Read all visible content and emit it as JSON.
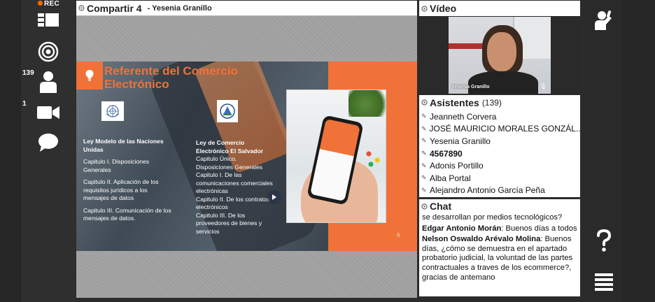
{
  "recording": {
    "label": "REC"
  },
  "toolbar": {
    "participants_count": "139",
    "camera_count": "1"
  },
  "share": {
    "title": "Compartir 4",
    "presenter": "- Yesenia Granillo",
    "slide": {
      "title": "Referente del Comercio Electrónico",
      "col1_heading": "Ley Modelo de las Naciones Unidas",
      "col1_items": [
        "Capitulo I. Disposiciones Generales",
        "Capitulo II. Aplicación de los requisitos jurídicos a los mensajes de datos",
        "Capitulo III. Comunicación de los mensajes de datos."
      ],
      "col2_heading": "Ley de Comercio Electrónico El Salvador",
      "col2_items": [
        "Capitulo Único. Disposiciones Generales",
        "Capitulo I. De las comunicaciones comerciales electrónicas",
        "Capitulo II. De los contratos electrónicos",
        "Capitulo III. De los proveedores de bienes y servicios"
      ],
      "page_number": "6"
    }
  },
  "video": {
    "title": "Vídeo",
    "participant_name": "Yesenia Granillo"
  },
  "attendees": {
    "title": "Asistentes",
    "count": "(139)",
    "list": [
      {
        "name": "Jeanneth Corvera",
        "bold": false
      },
      {
        "name": "JOSÉ MAURICIO MORALES GONZÁL...",
        "bold": false
      },
      {
        "name": "Yesenia Granillo",
        "bold": false
      },
      {
        "name": "4567890",
        "bold": true
      },
      {
        "name": "Adonis Portillo",
        "bold": false
      },
      {
        "name": "Alba Portal",
        "bold": false
      },
      {
        "name": "Alejandro Antonio García Peña",
        "bold": false
      }
    ]
  },
  "chat": {
    "title": "Chat",
    "messages": [
      {
        "author": "",
        "text": "se desarrollan por medios tecnológicos?"
      },
      {
        "author": "Edgar Antonio Morán",
        "text": ": Buenos días a todos"
      },
      {
        "author": "Nelson Oswaldo Arévalo Molina",
        "text": ": Buenos días, ¿cómo se demuestra en el apartado probatorio judicial, la voluntad de las partes contractuales a traves de los ecommerce?, gracias de antemano"
      }
    ]
  },
  "colors": {
    "accent_orange": "#f07238",
    "rec_dot": "#ff6a00"
  }
}
